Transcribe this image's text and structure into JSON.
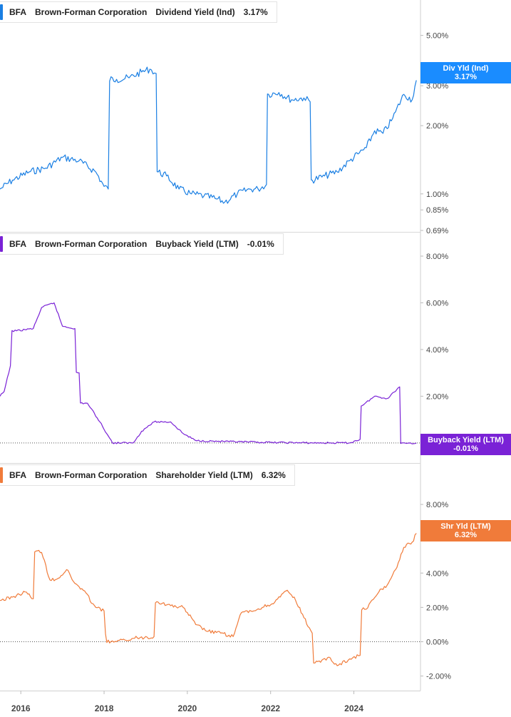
{
  "chart_data": [
    {
      "type": "line",
      "ticker": "BFA",
      "company": "Brown-Forman Corporation",
      "metric": "Dividend Yield (Ind)",
      "current": "3.17%",
      "tag_label": "Div Yld (Ind)",
      "tag_value": "3.17%",
      "color": "#1a7fe3",
      "scale": "log",
      "ylim": [
        0.69,
        5.6
      ],
      "yticks": [
        {
          "v": 5.0,
          "t": "5.00%"
        },
        {
          "v": 3.0,
          "t": "3.00%"
        },
        {
          "v": 2.0,
          "t": "2.00%"
        },
        {
          "v": 1.0,
          "t": "1.00%"
        },
        {
          "v": 0.85,
          "t": "0.85%"
        },
        {
          "v": 0.69,
          "t": "0.69%"
        }
      ],
      "x": [
        2015.5,
        2015.8,
        2016.2,
        2016.6,
        2017.0,
        2017.4,
        2017.8,
        2018.0,
        2018.1,
        2018.3,
        2018.6,
        2018.9,
        2019.1,
        2019.25,
        2019.3,
        2019.5,
        2019.8,
        2020.1,
        2020.4,
        2020.7,
        2020.9,
        2021.2,
        2021.5,
        2021.7,
        2021.9,
        2021.95,
        2022.2,
        2022.5,
        2022.8,
        2022.95,
        2023.0,
        2023.3,
        2023.6,
        2023.9,
        2024.1,
        2024.3,
        2024.5,
        2024.7,
        2024.9,
        2025.0,
        2025.2,
        2025.4,
        2025.5
      ],
      "values": [
        1.05,
        1.15,
        1.25,
        1.3,
        1.45,
        1.4,
        1.25,
        1.08,
        1.05,
        3.2,
        3.25,
        3.45,
        3.55,
        3.4,
        1.25,
        1.2,
        1.05,
        1.0,
        0.98,
        0.95,
        0.92,
        1.0,
        1.05,
        1.05,
        1.1,
        2.75,
        2.8,
        2.6,
        2.65,
        2.55,
        1.15,
        1.2,
        1.25,
        1.4,
        1.5,
        1.6,
        1.9,
        1.85,
        2.1,
        2.3,
        2.75,
        2.6,
        3.17
      ],
      "baseline": null
    },
    {
      "type": "line",
      "ticker": "BFA",
      "company": "Brown-Forman Corporation",
      "metric": "Buyback Yield (LTM)",
      "current": "-0.01%",
      "tag_label": "Buyback Yield (LTM)",
      "tag_value": "-0.01%",
      "color": "#7a22d6",
      "scale": "linear",
      "ylim": [
        -0.8,
        8.0
      ],
      "yticks": [
        {
          "v": 8,
          "t": "8.00%"
        },
        {
          "v": 6,
          "t": "6.00%"
        },
        {
          "v": 4,
          "t": "4.00%"
        },
        {
          "v": 2,
          "t": "2.00%"
        }
      ],
      "x": [
        2015.5,
        2015.6,
        2015.75,
        2015.9,
        2016.3,
        2016.5,
        2016.8,
        2017.0,
        2017.3,
        2017.4,
        2017.6,
        2017.9,
        2018.1,
        2018.2,
        2018.7,
        2018.9,
        2019.2,
        2019.6,
        2019.9,
        2020.2,
        2021.0,
        2022.0,
        2023.0,
        2023.5,
        2023.9,
        2024.15,
        2024.2,
        2024.5,
        2024.8,
        2025.1,
        2025.15,
        2025.3,
        2025.5
      ],
      "values": [
        2.0,
        2.2,
        3.3,
        4.8,
        4.9,
        5.8,
        6.0,
        5.0,
        4.9,
        3.0,
        1.7,
        0.9,
        0.3,
        0.0,
        0.0,
        0.5,
        0.9,
        0.9,
        0.4,
        0.1,
        0.05,
        0.02,
        0.0,
        0.0,
        0.0,
        0.15,
        1.6,
        2.0,
        1.9,
        2.4,
        0.0,
        -0.01,
        -0.01
      ],
      "baseline": 0
    },
    {
      "type": "line",
      "ticker": "BFA",
      "company": "Brown-Forman Corporation",
      "metric": "Shareholder Yield (LTM)",
      "current": "6.32%",
      "tag_label": "Shr Yld (LTM)",
      "tag_value": "6.32%",
      "color": "#f07b3a",
      "scale": "linear",
      "ylim": [
        -2.6,
        9.0
      ],
      "yticks": [
        {
          "v": 8,
          "t": "8.00%"
        },
        {
          "v": 6,
          "t": "6.00%"
        },
        {
          "v": 4,
          "t": "4.00%"
        },
        {
          "v": 2,
          "t": "2.00%"
        },
        {
          "v": 0,
          "t": "0.00%"
        },
        {
          "v": -2,
          "t": "-2.00%"
        }
      ],
      "x": [
        2015.5,
        2015.8,
        2016.1,
        2016.3,
        2016.4,
        2016.5,
        2016.7,
        2016.9,
        2017.1,
        2017.3,
        2017.5,
        2017.8,
        2018.0,
        2018.3,
        2018.5,
        2018.7,
        2019.2,
        2019.3,
        2019.6,
        2019.9,
        2020.0,
        2020.2,
        2020.5,
        2020.8,
        2021.1,
        2021.3,
        2021.6,
        2021.8,
        2022.1,
        2022.4,
        2022.6,
        2022.8,
        2023.0,
        2023.2,
        2023.4,
        2023.6,
        2023.9,
        2024.15,
        2024.3,
        2024.6,
        2024.8,
        2025.0,
        2025.2,
        2025.4,
        2025.5
      ],
      "values": [
        2.4,
        2.6,
        2.9,
        2.5,
        5.3,
        5.2,
        3.6,
        3.7,
        4.2,
        3.4,
        3.0,
        2.0,
        1.8,
        0.0,
        0.1,
        0.2,
        0.3,
        2.3,
        2.1,
        2.0,
        1.7,
        1.0,
        0.6,
        0.5,
        0.3,
        1.7,
        1.8,
        2.0,
        2.3,
        3.0,
        2.4,
        1.4,
        0.5,
        -1.2,
        -0.9,
        -1.4,
        -1.0,
        -0.8,
        1.9,
        2.9,
        3.3,
        4.2,
        5.5,
        5.8,
        6.32
      ],
      "baseline": 0
    }
  ],
  "x_axis": {
    "range": [
      2015.5,
      2025.6
    ],
    "ticks": [
      {
        "v": 2016,
        "t": "2016"
      },
      {
        "v": 2018,
        "t": "2018"
      },
      {
        "v": 2020,
        "t": "2020"
      },
      {
        "v": 2022,
        "t": "2022"
      },
      {
        "v": 2024,
        "t": "2024"
      }
    ]
  }
}
